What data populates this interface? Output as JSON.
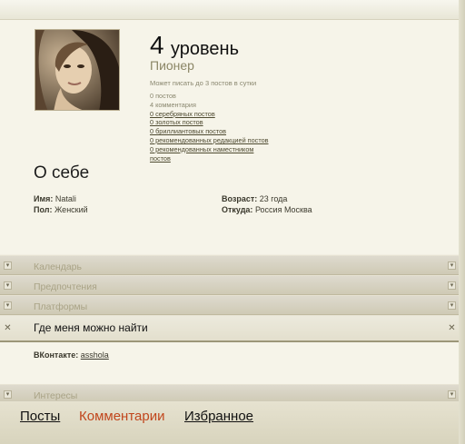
{
  "profile": {
    "level_number": "4",
    "level_word": "уровень",
    "rank": "Пионер",
    "can_post": "Может писать до 3 постов в сутки",
    "stats": [
      {
        "text": "0 постов",
        "link": false
      },
      {
        "text": "4 комментария",
        "link": false
      },
      {
        "text": "0 серебряных постов",
        "link": true
      },
      {
        "text": "0 золотых постов",
        "link": true
      },
      {
        "text": "0 бриллиантовых постов",
        "link": true
      },
      {
        "text": "0 рекомендованных редакцией постов",
        "link": true
      },
      {
        "text": "0 рекомендованных наместником",
        "link": true
      },
      {
        "text": "постов",
        "link": true
      }
    ]
  },
  "about": {
    "title": "О себе",
    "name_label": "Имя:",
    "name_value": "Natali",
    "gender_label": "Пол:",
    "gender_value": "Женский",
    "age_label": "Возраст:",
    "age_value": "23 года",
    "from_label": "Откуда:",
    "from_value": "Россия Москва"
  },
  "panels": {
    "calendar": "Календарь",
    "preferences": "Предпочтения",
    "platforms": "Платформы",
    "where_to_find": "Где меня можно найти",
    "interests": "Интересы"
  },
  "where_to_find": {
    "vk_label": "ВКонтакте:",
    "vk_value": "asshola"
  },
  "tabs": {
    "posts": "Посты",
    "comments": "Комментарии",
    "favorites": "Избранное"
  },
  "icons": {
    "collapsed_toggle": "triangle-down-icon",
    "expanded_toggle": "close-x-icon"
  },
  "colors": {
    "active_tab": "#c1461d",
    "muted_text": "#a9a386"
  }
}
